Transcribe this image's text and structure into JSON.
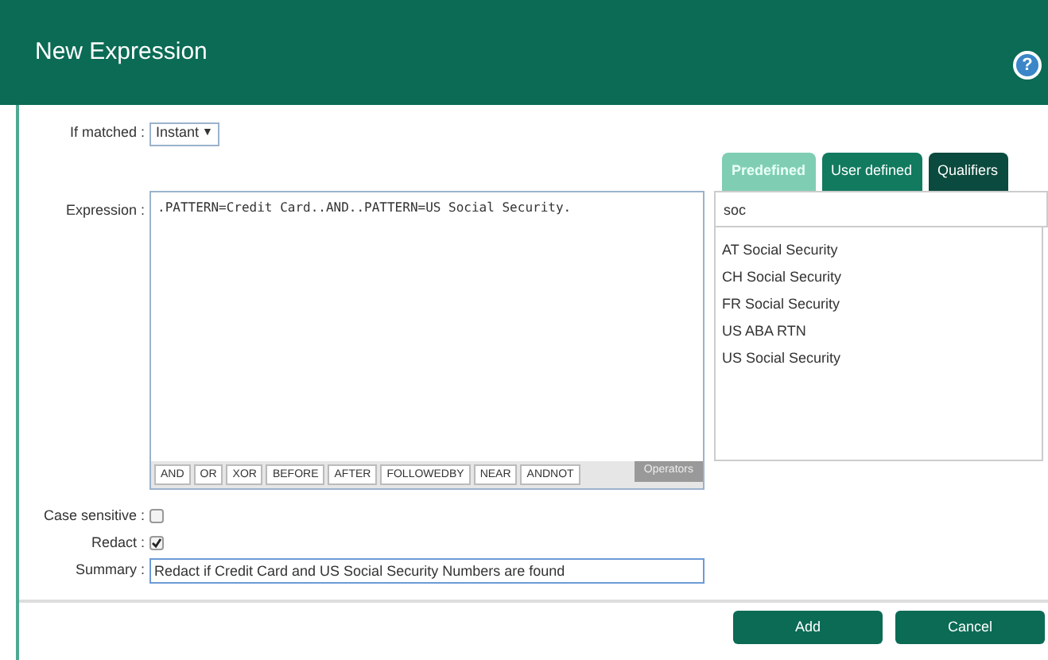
{
  "window": {
    "title": "New Expression",
    "help": "?"
  },
  "if_matched": {
    "label": "If matched :",
    "value": "Instant",
    "caret": "▼"
  },
  "expression": {
    "label": "Expression :",
    "value": ".PATTERN=Credit Card..AND..PATTERN=US Social Security."
  },
  "operators": {
    "label": "Operators",
    "buttons": [
      "AND",
      "OR",
      "XOR",
      "BEFORE",
      "AFTER",
      "FOLLOWEDBY",
      "NEAR",
      "ANDNOT"
    ]
  },
  "tabs": [
    {
      "label": "Predefined",
      "selected": true,
      "color": "#7fceb4"
    },
    {
      "label": "User defined",
      "selected": false,
      "color": "#117a5f"
    },
    {
      "label": "Qualifiers",
      "selected": false,
      "color": "#0b4a3e"
    }
  ],
  "search": {
    "value": "soc"
  },
  "results": [
    "AT Social Security",
    "CH Social Security",
    "FR Social Security",
    "US ABA RTN",
    "US Social Security"
  ],
  "options": [
    {
      "label": "Case sensitive :",
      "checked": false
    },
    {
      "label": "Redact :",
      "checked": true
    }
  ],
  "summary": {
    "label": "Summary :",
    "value": "Redact if Credit Card and US Social Security Numbers are found"
  },
  "buttons": [
    "Add",
    "Cancel"
  ]
}
